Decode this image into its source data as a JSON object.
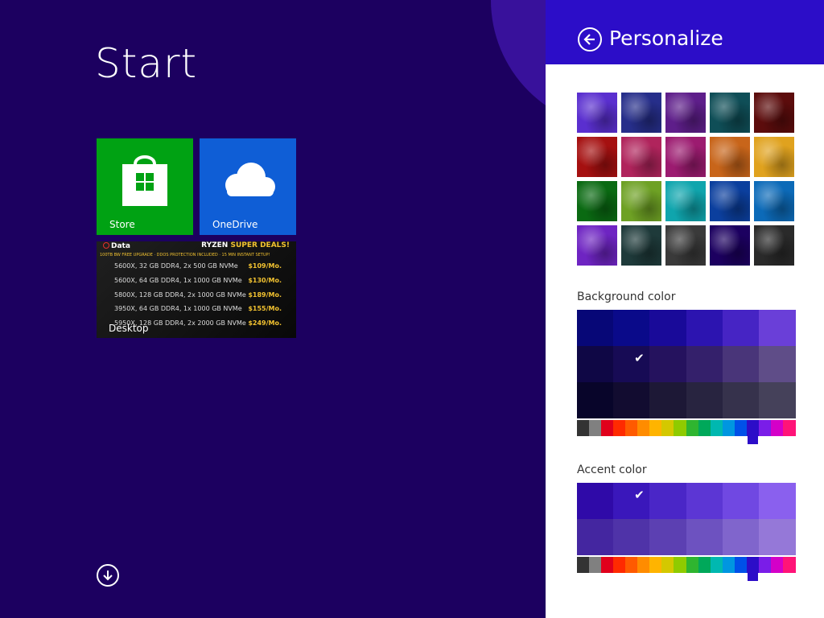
{
  "start": {
    "title": "Start",
    "tiles": [
      {
        "label": "Store",
        "color": "#00a213"
      },
      {
        "label": "OneDrive",
        "color": "#0f5ed6"
      },
      {
        "label": "Desktop",
        "color": "#1a1a1a"
      }
    ]
  },
  "desktop_ad": {
    "brand_prefix": "Data",
    "brand_suffix": "",
    "headline": "RYZEN",
    "headline_accent": "SUPER DEALS!",
    "banner": "100TB BW FREE UPGRADE · DDOS PROTECTION INCLUDED · 15 MIN INSTANT SETUP!",
    "rows": [
      {
        "spec": "5600X, 32 GB DDR4, 2x 500 GB NVMe",
        "price": "$109/Mo."
      },
      {
        "spec": "5600X, 64 GB DDR4, 1x 1000 GB NVMe",
        "price": "$130/Mo."
      },
      {
        "spec": "5800X, 128 GB DDR4, 2x 1000 GB NVMe",
        "price": "$189/Mo."
      },
      {
        "spec": "3950X, 64 GB DDR4, 1x 1000 GB NVMe",
        "price": "$155/Mo."
      },
      {
        "spec": "5950X, 128 GB DDR4, 2x 2000 GB NVMe",
        "price": "$249/Mo."
      }
    ]
  },
  "personalize": {
    "title": "Personalize",
    "header_color": "#2c0dc8",
    "background_label": "Background color",
    "accent_label": "Accent color",
    "patterns": [
      [
        "#5a2fcf",
        "#262e8a",
        "#5e1e8a",
        "#0f4e57",
        "#5c0c0c"
      ],
      [
        "#a51010",
        "#b0245c",
        "#9c1b70",
        "#c8651a",
        "#e0a21e"
      ],
      [
        "#0a6a12",
        "#6ea124",
        "#0fa5ad",
        "#0b3f9e",
        "#0c6ab8"
      ],
      [
        "#6e24c2",
        "#1e3a3a",
        "#3a3a3a",
        "#1c0060",
        "#2a2a2a"
      ]
    ],
    "background_colors": [
      [
        "#070777",
        "#0a0a8a",
        "#190a99",
        "#2c14b0",
        "#4624c4",
        "#6a3fd8"
      ],
      [
        "#0f0745",
        "#170b55",
        "#25125e",
        "#34206b",
        "#493579",
        "#5f4d88"
      ],
      [
        "#08052a",
        "#120c30",
        "#1d1836",
        "#282440",
        "#36324c",
        "#45415a"
      ]
    ],
    "accent_colors": [
      [
        "#2f0aa8",
        "#3a17bb",
        "#4a26c7",
        "#5c36d4",
        "#7048e2",
        "#8a60ee"
      ],
      [
        "#4426a0",
        "#4f33a8",
        "#5c40b2",
        "#6d52c0",
        "#8065cc",
        "#9578d8"
      ]
    ],
    "hues": [
      "#333333",
      "#808080",
      "#e0001b",
      "#ff2a00",
      "#ff5a00",
      "#ff8c00",
      "#ffb400",
      "#d4c800",
      "#8fcb00",
      "#2fb530",
      "#00a85a",
      "#00b8b0",
      "#0096e0",
      "#0050e8",
      "#2c0dc8",
      "#7a1de8",
      "#d400c8",
      "#ff1478"
    ]
  }
}
